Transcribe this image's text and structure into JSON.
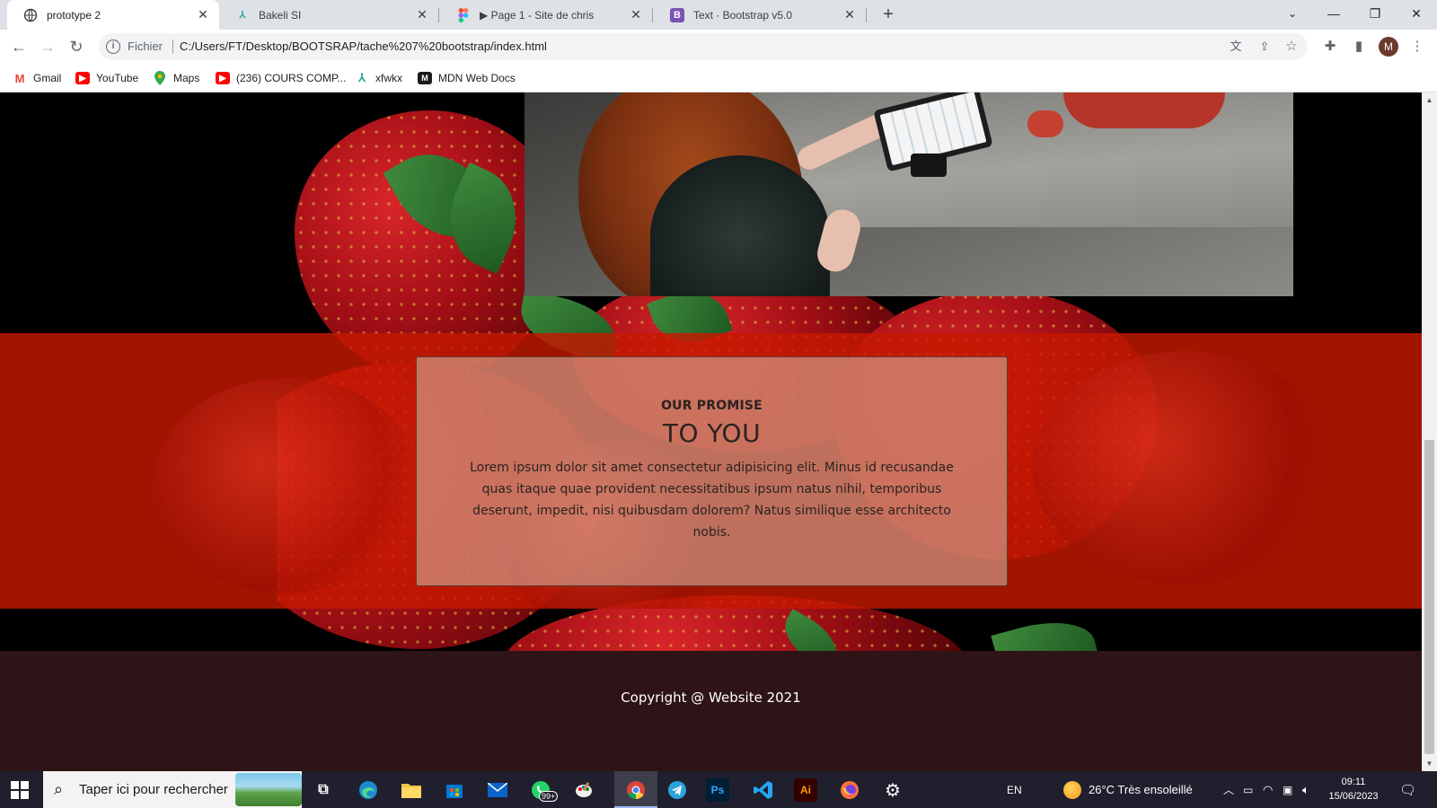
{
  "browser": {
    "tabs": [
      {
        "title": "prototype 2",
        "icon": "globe-icon",
        "active": true
      },
      {
        "title": "Bakeli SI",
        "icon": "bakeli-icon",
        "active": false
      },
      {
        "title": "▶ Page 1 - Site de chris",
        "icon": "figma-icon",
        "active": false
      },
      {
        "title": "Text · Bootstrap v5.0",
        "icon": "bootstrap-icon",
        "active": false
      }
    ],
    "address": {
      "chip": "Fichier",
      "url": "C:/Users/FT/Desktop/BOOTSRAP/tache%207%20bootstrap/index.html"
    },
    "profile_initial": "M",
    "bookmarks": [
      {
        "label": "Gmail",
        "icon": "gmail-icon"
      },
      {
        "label": "YouTube",
        "icon": "youtube-icon"
      },
      {
        "label": "Maps",
        "icon": "maps-icon"
      },
      {
        "label": "(236) COURS COMP...",
        "icon": "youtube-icon"
      },
      {
        "label": "xfwkx",
        "icon": "bakeli-icon"
      },
      {
        "label": "MDN Web Docs",
        "icon": "mdn-icon"
      }
    ]
  },
  "page": {
    "promise": {
      "kicker": "OUR PROMISE",
      "heading": "TO YOU",
      "text": "Lorem ipsum dolor sit amet consectetur adipisicing elit. Minus id recusandae quas itaque quae provident necessitatibus ipsum natus nihil, temporibus deserunt, impedit, nisi quibusdam dolorem? Natus similique esse architecto nobis."
    },
    "footer": {
      "copyright": "Copyright @ Website 2021"
    }
  },
  "taskbar": {
    "search_placeholder": "Taper ici pour rechercher",
    "whatsapp_badge": "99+",
    "language": "EN",
    "weather": "26°C  Très ensoleillé",
    "time": "09:11",
    "date": "15/06/2023"
  },
  "colors": {
    "promise_band": "#c41800",
    "footer_bg": "#2e1416",
    "card_border": "#5a3e36"
  }
}
